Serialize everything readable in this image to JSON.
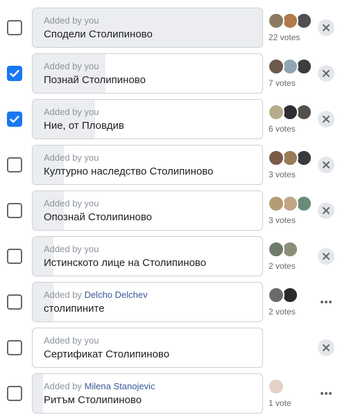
{
  "poll": {
    "options": [
      {
        "added_prefix": "Added by you",
        "author": "",
        "label": "Сподели Столипиново",
        "votes": "22 votes",
        "vote_count": 22,
        "checked": false,
        "action": "remove",
        "action_icon": "close-icon",
        "avatar_colors": [
          "#8a7a62",
          "#b07a4c",
          "#4f4e52"
        ]
      },
      {
        "added_prefix": "Added by you",
        "author": "",
        "label": "Познай Столипиново",
        "votes": "7 votes",
        "vote_count": 7,
        "checked": true,
        "action": "remove",
        "action_icon": "close-icon",
        "avatar_colors": [
          "#6d5a4e",
          "#8fa7b4",
          "#3c3d3f"
        ]
      },
      {
        "added_prefix": "Added by you",
        "author": "",
        "label": "Ние, от Пловдив",
        "votes": "6 votes",
        "vote_count": 6,
        "checked": true,
        "action": "remove",
        "action_icon": "close-icon",
        "avatar_colors": [
          "#b5ac8c",
          "#2f2f31",
          "#55504c"
        ]
      },
      {
        "added_prefix": "Added by you",
        "author": "",
        "label": "Културно наследство Столипиново",
        "votes": "3 votes",
        "vote_count": 3,
        "checked": false,
        "action": "remove",
        "action_icon": "close-icon",
        "avatar_colors": [
          "#7b5a4a",
          "#9a7b57",
          "#3a3a3c"
        ]
      },
      {
        "added_prefix": "Added by you",
        "author": "",
        "label": "Опознай Столипиново",
        "votes": "3 votes",
        "vote_count": 3,
        "checked": false,
        "action": "remove",
        "action_icon": "close-icon",
        "avatar_colors": [
          "#b59b72",
          "#c2a685",
          "#6a8a7a"
        ]
      },
      {
        "added_prefix": "Added by you",
        "author": "",
        "label": "Истинското лице на Столипиново",
        "votes": "2 votes",
        "vote_count": 2,
        "checked": false,
        "action": "remove",
        "action_icon": "close-icon",
        "avatar_colors": [
          "#6f7c6a",
          "#8b8f78"
        ]
      },
      {
        "added_prefix": "Added by",
        "author": "Delcho Delchev",
        "label": "столипините",
        "votes": "2 votes",
        "vote_count": 2,
        "checked": false,
        "action": "more",
        "action_icon": "more-icon",
        "avatar_colors": [
          "#6b6b6b",
          "#2a2a2a"
        ]
      },
      {
        "added_prefix": "Added by you",
        "author": "",
        "label": "Сертификат Столипиново",
        "votes": "",
        "vote_count": 0,
        "checked": false,
        "action": "remove",
        "action_icon": "close-icon",
        "avatar_colors": []
      },
      {
        "added_prefix": "Added by",
        "author": "Milena Stanojevic",
        "label": "Ритъм Столипиново",
        "votes": "1 vote",
        "vote_count": 1,
        "checked": false,
        "action": "more",
        "action_icon": "more-icon",
        "avatar_colors": [
          "#e3d3c8"
        ]
      }
    ],
    "max_votes": 22
  },
  "colors": {
    "accent": "#1877f2",
    "author_link": "#385898",
    "result_fill": "#ebedf0"
  }
}
